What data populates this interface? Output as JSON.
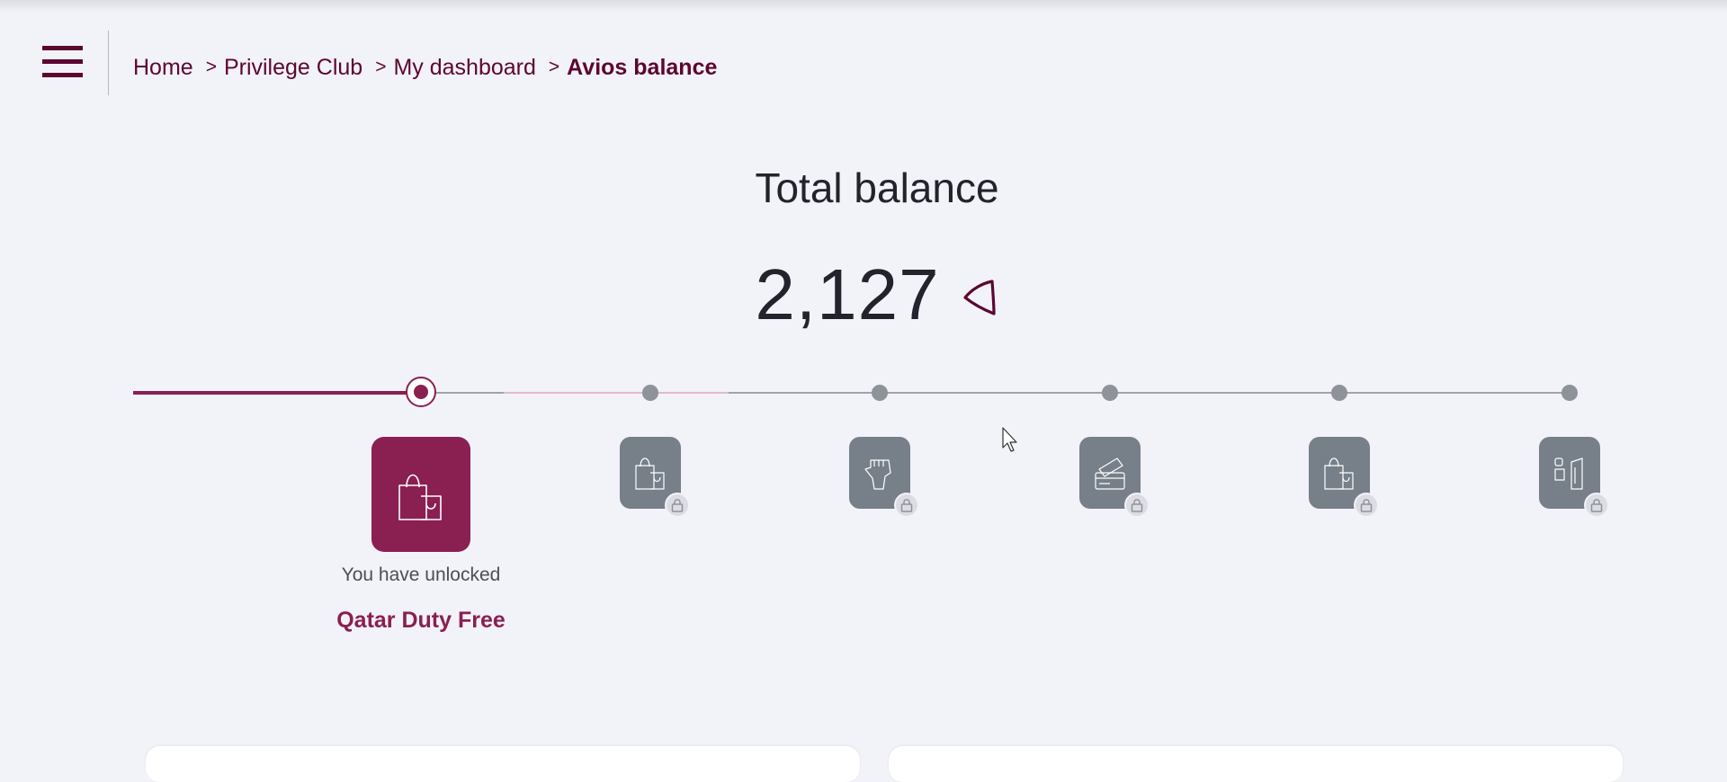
{
  "breadcrumb": {
    "items": [
      {
        "label": "Home"
      },
      {
        "label": "Privilege Club"
      },
      {
        "label": "My dashboard"
      }
    ],
    "current": "Avios balance",
    "separator": ">"
  },
  "balance": {
    "title": "Total balance",
    "value": "2,127",
    "currency_icon": "avios-icon"
  },
  "milestones": {
    "progress_fraction": 0.25,
    "unlocked_index": 0,
    "nodes": [
      {
        "icon": "shopping-bags-icon",
        "locked": false
      },
      {
        "icon": "shopping-bags-icon",
        "locked": true
      },
      {
        "icon": "hand-icon",
        "locked": true
      },
      {
        "icon": "ticket-card-icon",
        "locked": true
      },
      {
        "icon": "shopping-bags-icon",
        "locked": true
      },
      {
        "icon": "cabin-seat-icon",
        "locked": true
      }
    ],
    "unlocked_text": "You have unlocked",
    "unlocked_name": "Qatar Duty Free"
  },
  "colors": {
    "brand": "#5c0632",
    "accent": "#8a1f52",
    "locked": "#777f89",
    "background": "#f2f2f9"
  }
}
